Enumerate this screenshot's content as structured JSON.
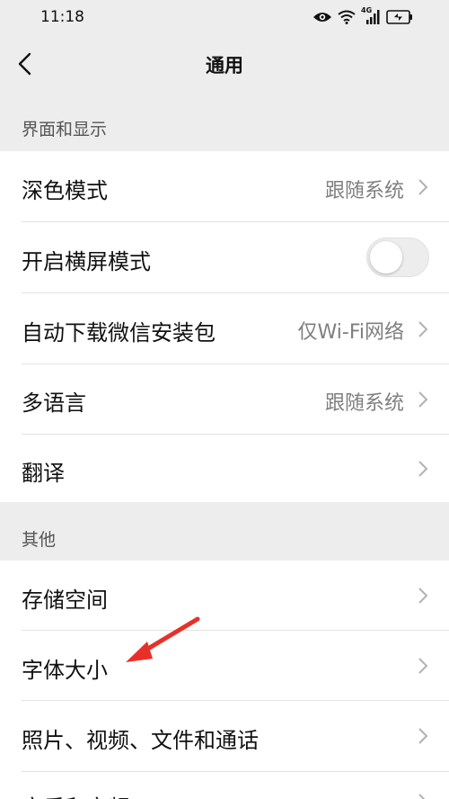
{
  "status_bar": {
    "time": "11:18",
    "network_label": "4G",
    "icons": [
      "eye-icon",
      "wifi-icon",
      "cellular-signal-icon",
      "battery-charging-icon"
    ]
  },
  "header": {
    "title": "通用",
    "back_icon": "back-chevron-icon"
  },
  "sections": [
    {
      "title": "界面和显示",
      "rows": [
        {
          "label": "深色模式",
          "value": "跟随系统"
        },
        {
          "label": "开启横屏模式",
          "toggle": false
        },
        {
          "label": "自动下载微信安装包",
          "value": "仅Wi-Fi网络"
        },
        {
          "label": "多语言",
          "value": "跟随系统"
        },
        {
          "label": "翻译",
          "value": ""
        }
      ]
    },
    {
      "title": "其他",
      "rows": [
        {
          "label": "存储空间",
          "value": ""
        },
        {
          "label": "字体大小",
          "value": ""
        },
        {
          "label": "照片、视频、文件和通话",
          "value": ""
        },
        {
          "label": "音乐和音频",
          "value": ""
        }
      ]
    }
  ],
  "colors": {
    "background": "#ededed",
    "card": "#ffffff",
    "annotation_arrow": "#e8302a"
  }
}
